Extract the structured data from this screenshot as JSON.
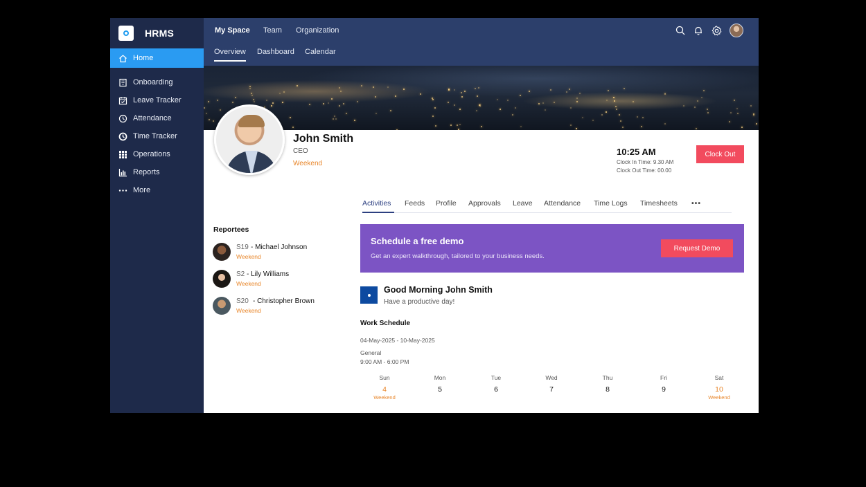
{
  "app": {
    "brand": "HRMS"
  },
  "sidebar": {
    "items": [
      {
        "label": "Home",
        "icon": "home-icon",
        "active": true
      },
      {
        "label": "Onboarding",
        "icon": "onboarding-icon"
      },
      {
        "label": "Leave Tracker",
        "icon": "calendar-check-icon"
      },
      {
        "label": "Attendance",
        "icon": "clock-icon"
      },
      {
        "label": "Time Tracker",
        "icon": "timer-icon"
      },
      {
        "label": "Operations",
        "icon": "grid-icon"
      },
      {
        "label": "Reports",
        "icon": "bar-chart-icon"
      },
      {
        "label": "More",
        "icon": "more-dots-icon"
      }
    ]
  },
  "topbar": {
    "tabs": [
      "My Space",
      "Team",
      "Organization"
    ],
    "subtabs": [
      "Overview",
      "Dashboard",
      "Calendar"
    ],
    "icons": [
      "search-icon",
      "bell-icon",
      "gear-icon",
      "user-avatar"
    ]
  },
  "profile": {
    "name": "John Smith",
    "role": "CEO",
    "status": "Weekend"
  },
  "clock": {
    "time": "10:25 AM",
    "clock_in": "Clock In Time: 9.30 AM",
    "clock_out": "Clock Out Time: 00.00",
    "button": "Clock Out"
  },
  "tabs": {
    "items": [
      "Activities",
      "Feeds",
      "Profile",
      "Approvals",
      "Leave",
      "Attendance",
      "Time Logs",
      "Timesheets"
    ],
    "more": "•••",
    "active": "Activities"
  },
  "reportees": {
    "title": "Reportees",
    "items": [
      {
        "id": "S19",
        "name": "- Michael Johnson",
        "status": "Weekend"
      },
      {
        "id": "S2",
        "name": "- Lily Williams",
        "status": "Weekend"
      },
      {
        "id": "S20",
        "name": "- Christopher Brown",
        "status": "Weekend"
      }
    ]
  },
  "demo": {
    "title": "Schedule a free demo",
    "subtitle": "Get an expert walkthrough, tailored to your business needs.",
    "button": "Request Demo"
  },
  "greeting": {
    "title": "Good Morning John Smith",
    "subtitle": "Have a productive day!"
  },
  "schedule": {
    "title": "Work Schedule",
    "range": "04-May-2025 - 10-May-2025",
    "shift": "General",
    "hours": "9:00 AM - 6:00 PM",
    "days": [
      {
        "name": "Sun",
        "num": "4",
        "status": "Weekend"
      },
      {
        "name": "Mon",
        "num": "5",
        "status": ""
      },
      {
        "name": "Tue",
        "num": "6",
        "status": ""
      },
      {
        "name": "Wed",
        "num": "7",
        "status": ""
      },
      {
        "name": "Thu",
        "num": "8",
        "status": ""
      },
      {
        "name": "Fri",
        "num": "9",
        "status": ""
      },
      {
        "name": "Sat",
        "num": "10",
        "status": "Weekend"
      }
    ]
  },
  "colors": {
    "sidebar": "#1e2a4a",
    "topbar": "#2c3f6b",
    "accent_blue": "#2a9bf2",
    "danger": "#f24b5e",
    "demo_purple": "#7c54c4",
    "weekend_orange": "#e8862a"
  }
}
